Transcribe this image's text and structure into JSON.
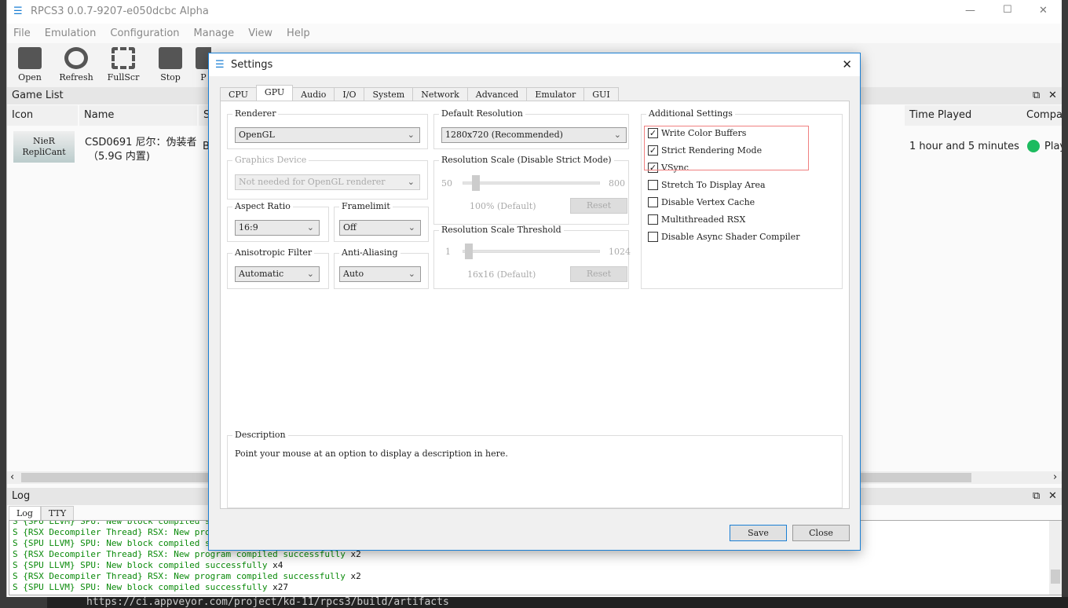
{
  "window": {
    "title": "RPCS3 0.0.7-9207-e050dcbc Alpha",
    "min": "—",
    "max": "☐",
    "close": "✕"
  },
  "menu": [
    "File",
    "Emulation",
    "Configuration",
    "Manage",
    "View",
    "Help"
  ],
  "toolbar": [
    {
      "label": "Open",
      "icon": "folder-icon"
    },
    {
      "label": "Refresh",
      "icon": "refresh-icon"
    },
    {
      "label": "FullScr",
      "icon": "fullscreen-icon"
    },
    {
      "label": "Stop",
      "icon": "stop-icon"
    },
    {
      "label": "P",
      "icon": "pause-icon"
    }
  ],
  "game_list": {
    "title": "Game List",
    "columns": [
      "Icon",
      "Name",
      "S",
      "Time Played",
      "Compat"
    ],
    "rows": [
      {
        "icon_text": "NieR RepliCant",
        "name": "CSD0691 尼尔：伪装者",
        "name2": "（5.9G 内置)",
        "serial": "B",
        "time_played": "1 hour and 5 minutes",
        "compat": "Play",
        "compat_color": "#1dbb5f"
      }
    ]
  },
  "log": {
    "title": "Log",
    "tabs": [
      "Log",
      "TTY"
    ],
    "lines": [
      {
        "text": "S {SPU LLVM} SPU: New block compiled succe",
        "count": ""
      },
      {
        "text": "S {RSX Decompiler Thread} RSX: New program",
        "count": ""
      },
      {
        "text": "S {SPU LLVM} SPU: New block compiled succe",
        "count": ""
      },
      {
        "text": "S {RSX Decompiler Thread} RSX: New program compiled successfully",
        "count": " x2"
      },
      {
        "text": "S {SPU LLVM} SPU: New block compiled successfully",
        "count": " x4"
      },
      {
        "text": "S {RSX Decompiler Thread} RSX: New program compiled successfully",
        "count": " x2"
      },
      {
        "text": "S {SPU LLVM} SPU: New block compiled successfully",
        "count": " x27"
      }
    ]
  },
  "background_text": "https://ci.appveyor.com/project/kd-11/rpcs3/build/artifacts",
  "settings": {
    "title": "Settings",
    "close": "✕",
    "tabs": [
      "CPU",
      "GPU",
      "Audio",
      "I/O",
      "System",
      "Network",
      "Advanced",
      "Emulator",
      "GUI"
    ],
    "active_tab": "GPU",
    "renderer": {
      "label": "Renderer",
      "value": "OpenGL"
    },
    "graphics_device": {
      "label": "Graphics Device",
      "value": "Not needed for OpenGL renderer"
    },
    "aspect_ratio": {
      "label": "Aspect Ratio",
      "value": "16:9"
    },
    "framelimit": {
      "label": "Framelimit",
      "value": "Off"
    },
    "anisotropic": {
      "label": "Anisotropic Filter",
      "value": "Automatic"
    },
    "antialiasing": {
      "label": "Anti-Aliasing",
      "value": "Auto"
    },
    "default_resolution": {
      "label": "Default Resolution",
      "value": "1280x720 (Recommended)"
    },
    "resolution_scale": {
      "label": "Resolution Scale (Disable Strict Mode)",
      "min": "50",
      "max": "800",
      "value_text": "100% (Default)",
      "value": 100,
      "reset": "Reset"
    },
    "resolution_threshold": {
      "label": "Resolution Scale Threshold",
      "min": "1",
      "max": "1024",
      "value_text": "16x16 (Default)",
      "value": 16,
      "reset": "Reset"
    },
    "additional": {
      "label": "Additional Settings",
      "items": [
        {
          "label": "Write Color Buffers",
          "checked": true
        },
        {
          "label": "Strict Rendering Mode",
          "checked": true
        },
        {
          "label": "VSync",
          "checked": true
        },
        {
          "label": "Stretch To Display Area",
          "checked": false
        },
        {
          "label": "Disable Vertex Cache",
          "checked": false
        },
        {
          "label": "Multithreaded RSX",
          "checked": false
        },
        {
          "label": "Disable Async Shader Compiler",
          "checked": false
        }
      ],
      "highlight_color": "#f08080"
    },
    "description": {
      "label": "Description",
      "text": "Point your mouse at an option to display a description in here."
    },
    "save": "Save",
    "close_button": "Close"
  }
}
